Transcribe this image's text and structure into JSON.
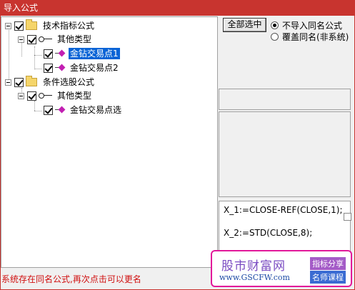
{
  "window": {
    "title": "导入公式"
  },
  "tree": {
    "roots": [
      {
        "label": "技术指标公式",
        "children": [
          {
            "label": "其他类型",
            "items": [
              "金钻交易点1",
              "金钻交易点2"
            ]
          }
        ]
      },
      {
        "label": "条件选股公式",
        "children": [
          {
            "label": "其他类型",
            "items": [
              "金钻交易点选"
            ]
          }
        ]
      }
    ],
    "selected_item": "金钻交易点1"
  },
  "controls": {
    "select_all_label": "全部选中",
    "radio_options": [
      {
        "label": "不导入同名公式",
        "selected": true
      },
      {
        "label": "覆盖同名(非系统)",
        "selected": false
      }
    ]
  },
  "code_preview": {
    "lines": [
      "X_1:=CLOSE-REF(CLOSE,1);",
      "X_2:=STD(CLOSE,8);"
    ]
  },
  "status_text": "系统存在同名公式,再次点击可以更名",
  "watermark": {
    "main": "股市财富网",
    "url": "www.GSCFW.com",
    "tag1": "指标分享",
    "tag2": "名师课程"
  },
  "colors": {
    "titlebar": "#c8342f",
    "selection": "#0a64d6",
    "status_text": "#d01010",
    "watermark_border": "#e2189a"
  }
}
